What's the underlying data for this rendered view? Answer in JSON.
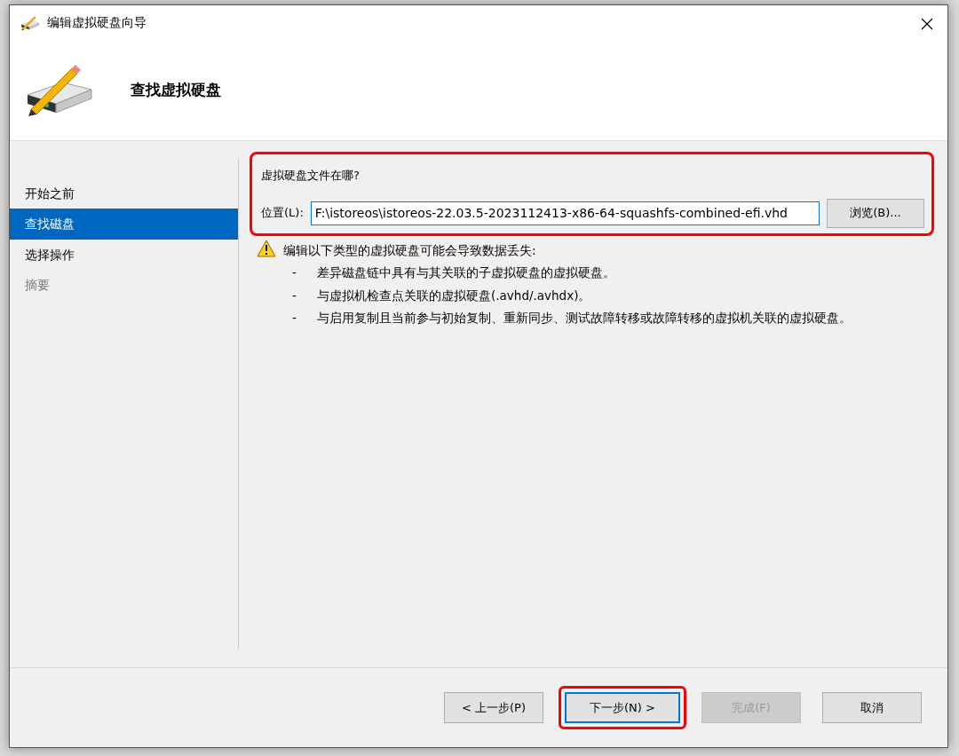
{
  "window": {
    "title": "编辑虚拟硬盘向导"
  },
  "header": {
    "title": "查找虚拟硬盘"
  },
  "steps": [
    {
      "label": "开始之前",
      "selected": false,
      "disabled": false
    },
    {
      "label": "查找磁盘",
      "selected": true,
      "disabled": false
    },
    {
      "label": "选择操作",
      "selected": false,
      "disabled": false
    },
    {
      "label": "摘要",
      "selected": false,
      "disabled": true
    }
  ],
  "location_section": {
    "highlighted": true,
    "question": "虚拟硬盘文件在哪?",
    "field_label": "位置(L):",
    "value": "F:\\istoreos\\istoreos-22.03.5-2023112413-x86-64-squashfs-combined-efi.vhd",
    "browse_button": "浏览(B)..."
  },
  "warning": {
    "text": "编辑以下类型的虚拟硬盘可能会导致数据丢失:",
    "items": [
      {
        "bullet": "-",
        "text": "差异磁盘链中具有与其关联的子虚拟硬盘的虚拟硬盘。"
      },
      {
        "bullet": "-",
        "text": "与虚拟机检查点关联的虚拟硬盘(.avhd/.avhdx)。"
      },
      {
        "bullet": "-",
        "text": "与启用复制且当前参与初始复制、重新同步、测试故障转移或故障转移的虚拟机关联的虚拟硬盘。"
      }
    ]
  },
  "buttons": [
    {
      "label": "< 上一步(P)",
      "disabled": false,
      "default": false,
      "highlighted": false
    },
    {
      "label": "下一步(N) >",
      "disabled": false,
      "default": true,
      "highlighted": true
    },
    {
      "label": "完成(F)",
      "disabled": true,
      "default": false,
      "highlighted": false
    },
    {
      "label": "取消",
      "disabled": false,
      "default": false,
      "highlighted": false
    }
  ]
}
